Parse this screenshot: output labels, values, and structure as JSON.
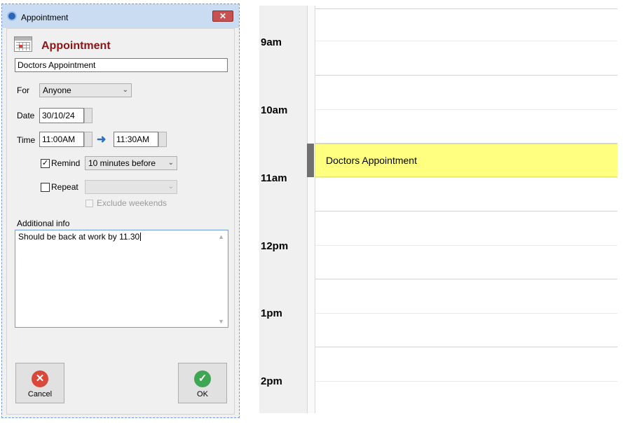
{
  "dialog": {
    "window_title": "Appointment",
    "close_glyph": "✕",
    "heading": "Appointment",
    "subject_value": "Doctors Appointment",
    "for_label": "For",
    "for_value": "Anyone",
    "date_label": "Date",
    "date_value": "30/10/24",
    "time_label": "Time",
    "start_time": "11:00AM",
    "end_time": "11:30AM",
    "remind_label": "Remind",
    "remind_checked": true,
    "remind_value": "10 minutes before",
    "repeat_label": "Repeat",
    "repeat_checked": false,
    "repeat_value": "",
    "exclude_weekends_label": "Exclude weekends",
    "additional_info_label": "Additional info",
    "additional_info_value": "Should be back at work by 11.30",
    "cancel_label": "Cancel",
    "ok_label": "OK",
    "icons": [
      "app-icon",
      "calendar-icon",
      "arrow-right-icon",
      "cancel-x-icon",
      "ok-check-icon",
      "chevron-down-icon"
    ]
  },
  "calendar": {
    "hours": [
      "9am",
      "10am",
      "11am",
      "12pm",
      "1pm",
      "2pm"
    ],
    "event": {
      "title": "Doctors Appointment",
      "color": "#ffff80"
    }
  },
  "colors": {
    "heading": "#8b1518",
    "cancel_icon": "#d9483b",
    "ok_icon": "#3fa654",
    "arrow": "#2b6fbf",
    "event_bar": "#707070"
  }
}
